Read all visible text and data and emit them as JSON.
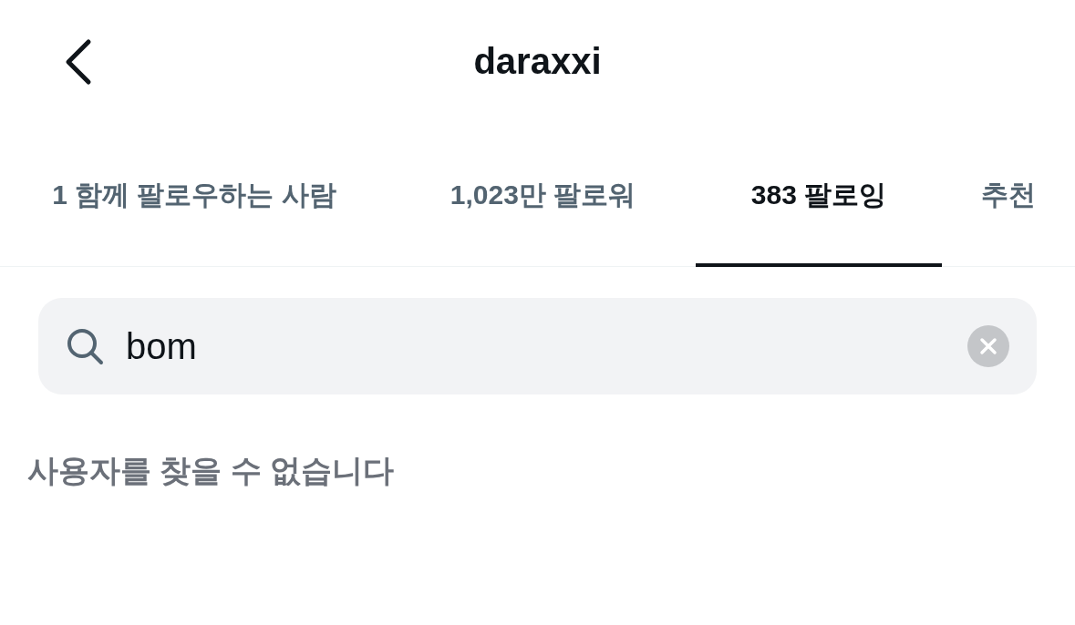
{
  "header": {
    "title": "daraxxi"
  },
  "tabs": [
    {
      "label": "**1** 함께 팔로우하는 사람",
      "selected": false
    },
    {
      "label": "**1,023만** 팔로워",
      "selected": false
    },
    {
      "label": "**383** 팔로잉",
      "selected": true
    },
    {
      "label": "추천",
      "selected": false
    }
  ],
  "search": {
    "value": "bom"
  },
  "message": "사용자를 찾을 수 없습니다"
}
